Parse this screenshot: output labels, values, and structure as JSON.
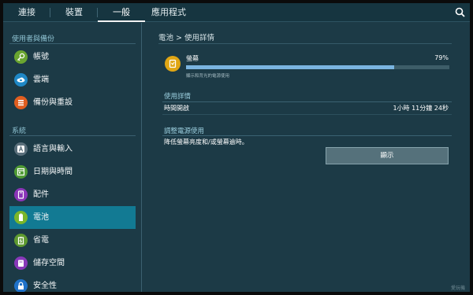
{
  "tabs": [
    {
      "label": "連接",
      "active": false
    },
    {
      "label": "裝置",
      "active": false
    },
    {
      "label": "一般",
      "active": true
    },
    {
      "label": "應用程式",
      "active": false
    }
  ],
  "search": {
    "icon": "search-icon"
  },
  "sidebar": {
    "section1": "使用者與備份",
    "section2": "系統",
    "items": [
      {
        "label": "帳號",
        "icon": "key-icon",
        "color": "#6aa530"
      },
      {
        "label": "雲端",
        "icon": "cloud-icon",
        "color": "#1f88c6"
      },
      {
        "label": "備份與重設",
        "icon": "backup-icon",
        "color": "#e05e20"
      },
      {
        "label": "語言與輸入",
        "icon": "language-icon",
        "color": "#5a6f7b"
      },
      {
        "label": "日期與時間",
        "icon": "calendar-icon",
        "color": "#4f9a34"
      },
      {
        "label": "配件",
        "icon": "accessory-icon",
        "color": "#8a35b8"
      },
      {
        "label": "電池",
        "icon": "battery-icon",
        "color": "#7bb62a",
        "selected": true
      },
      {
        "label": "省電",
        "icon": "power-saving-icon",
        "color": "#5e9a30"
      },
      {
        "label": "儲存空間",
        "icon": "storage-icon",
        "color": "#8838b9"
      },
      {
        "label": "安全性",
        "icon": "lock-icon",
        "color": "#1f72c9"
      }
    ]
  },
  "breadcrumb": {
    "parent": "電池",
    "separator": ">",
    "current": "使用詳情"
  },
  "usage": {
    "label": "螢幕",
    "percent_text": "79%",
    "fraction": 0.79,
    "description": "顯示和背光的電源使用",
    "icon": "battery-usage-icon"
  },
  "details": {
    "heading": "使用詳情",
    "time_label": "時間開啟",
    "time_value": "1小時 11分鐘 24秒"
  },
  "power": {
    "heading": "調整電源使用",
    "text": "降低螢幕亮度和/或螢幕逾時。",
    "button_label": "顯示"
  },
  "watermark": "愛玩機",
  "colors": {
    "accent": "#127a93",
    "background": "#1c3a46",
    "usage_fill": "#7ab4e0"
  }
}
